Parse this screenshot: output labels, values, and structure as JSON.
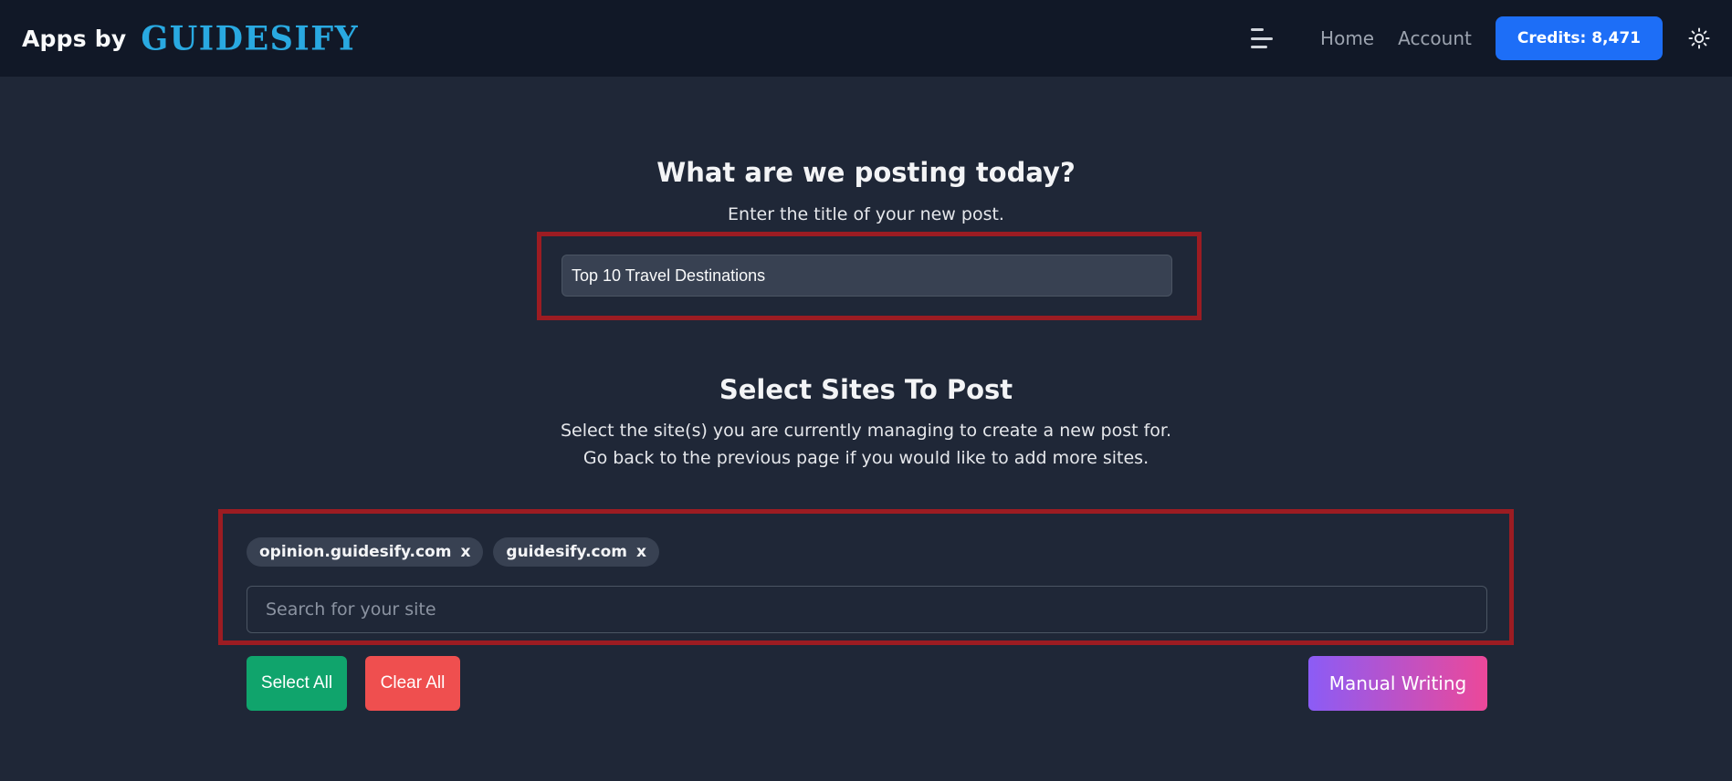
{
  "navbar": {
    "brand_prefix": "Apps by",
    "brand_logo": "GUIDESIFY",
    "menu_icon": "hamburger-menu-icon",
    "links": [
      {
        "label": "Home"
      },
      {
        "label": "Account"
      }
    ],
    "credits_label": "Credits: 8,471",
    "theme_icon": "sun-icon"
  },
  "colors": {
    "navbar_bg": "#111827",
    "page_bg": "#1f2737",
    "brand_accent": "#29a9e1",
    "credits_bg": "#1d6ef7",
    "select_all_bg": "#10a46c",
    "clear_all_bg": "#ef4f4f",
    "manual_gradient_start": "#8b5cf6",
    "manual_gradient_end": "#ec4899",
    "highlight_border": "#9c1c22"
  },
  "post": {
    "heading": "What are we posting today?",
    "subheading": "Enter the title of your new post.",
    "title_value": "Top 10 Travel Destinations"
  },
  "sites": {
    "heading": "Select Sites To Post",
    "description_line1": "Select the site(s) you are currently managing to create a new post for.",
    "description_line2": "Go back to the previous page if you would like to add more sites.",
    "selected": [
      {
        "label": "opinion.guidesify.com",
        "remove": "x"
      },
      {
        "label": "guidesify.com",
        "remove": "x"
      }
    ],
    "search_placeholder": "Search for your site",
    "select_all_label": "Select All",
    "clear_all_label": "Clear All",
    "manual_writing_label": "Manual Writing"
  }
}
